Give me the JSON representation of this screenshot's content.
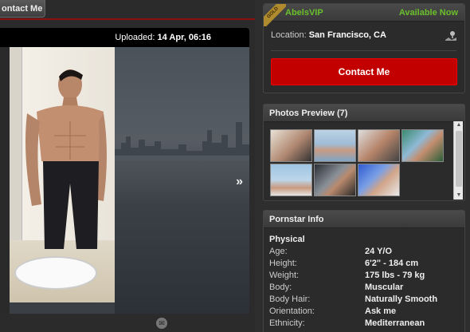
{
  "left": {
    "contact_tab": "ontact Me",
    "upload_label": "Uploaded:",
    "upload_date": "14 Apr, 06:16",
    "next_arrow": "»"
  },
  "profile": {
    "badge": "GOLD",
    "name": "AbelsVIP",
    "status": "Available Now",
    "location_label": "Location:",
    "location": "San Francisco, CA",
    "contact_button": "Contact Me"
  },
  "photos": {
    "title": "Photos Preview (7)",
    "thumbnails": [
      "photo-1",
      "photo-2",
      "photo-3",
      "photo-4",
      "photo-5",
      "photo-6",
      "photo-7"
    ]
  },
  "info": {
    "title": "Pornstar Info",
    "section": "Physical",
    "rows": [
      {
        "k": "Age:",
        "v": "24 Y/O"
      },
      {
        "k": "Height:",
        "v": "6'2\" - 184 cm"
      },
      {
        "k": "Weight:",
        "v": "175 lbs - 79 kg"
      },
      {
        "k": "Body:",
        "v": "Muscular"
      },
      {
        "k": "Body Hair:",
        "v": "Naturally Smooth"
      },
      {
        "k": "Orientation:",
        "v": "Ask me"
      },
      {
        "k": "Ethnicity:",
        "v": "Mediterranean"
      }
    ]
  },
  "colors": {
    "accent_green": "#6abf2a",
    "button_red": "#c20000",
    "gold": "#b08a2e"
  }
}
